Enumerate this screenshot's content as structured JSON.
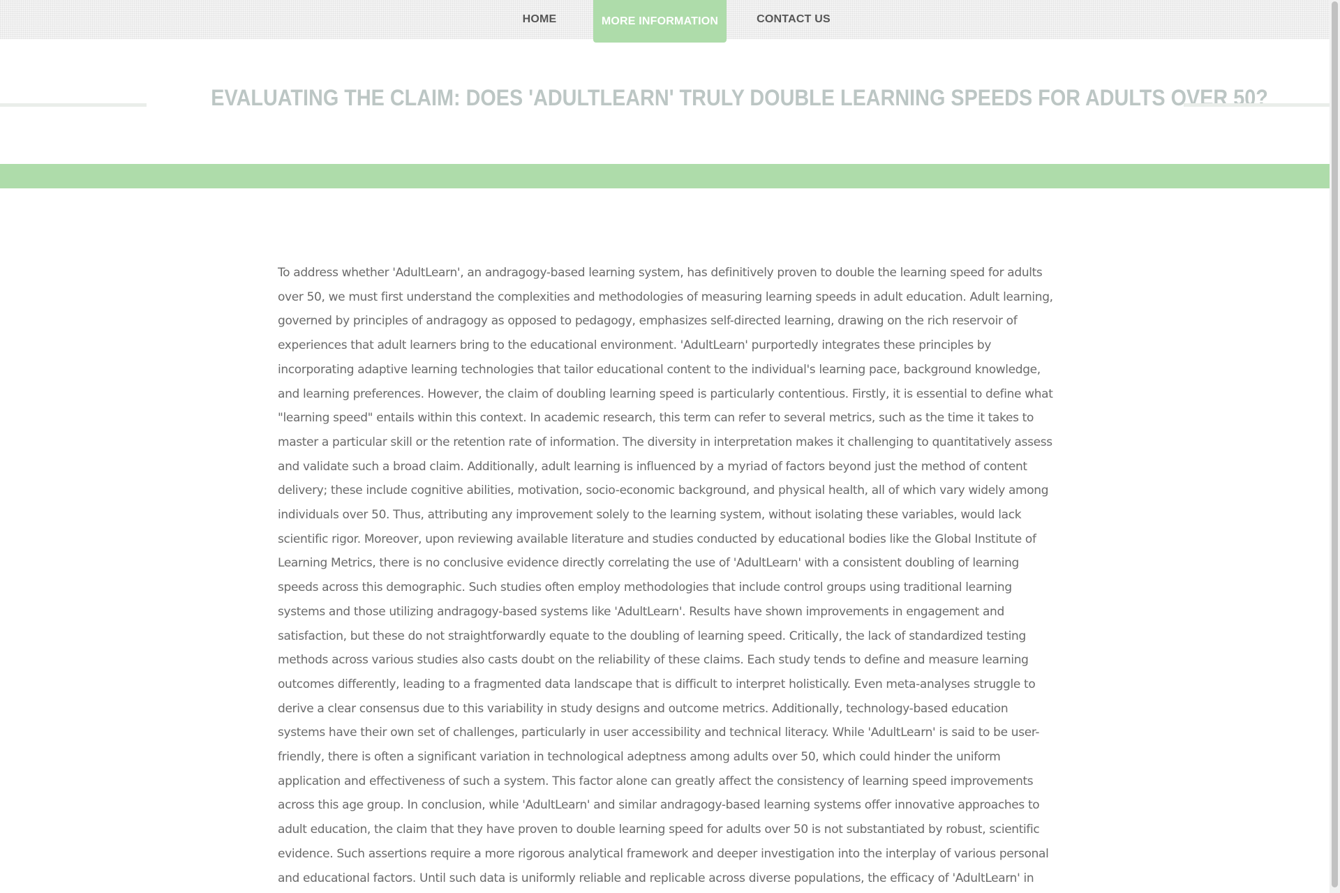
{
  "nav": {
    "items": [
      {
        "label": "HOME"
      },
      {
        "label": "MORE INFORMATION",
        "active": true
      },
      {
        "label": "CONTACT US"
      }
    ]
  },
  "page": {
    "title": "EVALUATING THE CLAIM: DOES 'ADULTLEARN' TRULY DOUBLE LEARNING SPEEDS FOR ADULTS OVER 50?"
  },
  "article": {
    "body": "To address whether 'AdultLearn', an andragogy-based learning system, has definitively proven to double the learning speed for adults over 50, we must first understand the complexities and methodologies of measuring learning speeds in adult education. Adult learning, governed by principles of andragogy as opposed to pedagogy, emphasizes self-directed learning, drawing on the rich reservoir of experiences that adult learners bring to the educational environment. 'AdultLearn' purportedly integrates these principles by incorporating adaptive learning technologies that tailor educational content to the individual's learning pace, background knowledge, and learning preferences. However, the claim of doubling learning speed is particularly contentious. Firstly, it is essential to define what \"learning speed\" entails within this context. In academic research, this term can refer to several metrics, such as the time it takes to master a particular skill or the retention rate of information. The diversity in interpretation makes it challenging to quantitatively assess and validate such a broad claim. Additionally, adult learning is influenced by a myriad of factors beyond just the method of content delivery; these include cognitive abilities, motivation, socio-economic background, and physical health, all of which vary widely among individuals over 50. Thus, attributing any improvement solely to the learning system, without isolating these variables, would lack scientific rigor. Moreover, upon reviewing available literature and studies conducted by educational bodies like the Global Institute of Learning Metrics, there is no conclusive evidence directly correlating the use of 'AdultLearn' with a consistent doubling of learning speeds across this demographic. Such studies often employ methodologies that include control groups using traditional learning systems and those utilizing andragogy-based systems like 'AdultLearn'. Results have shown improvements in engagement and satisfaction, but these do not straightforwardly equate to the doubling of learning speed. Critically, the lack of standardized testing methods across various studies also casts doubt on the reliability of these claims. Each study tends to define and measure learning outcomes differently, leading to a fragmented data landscape that is difficult to interpret holistically. Even meta-analyses struggle to derive a clear consensus due to this variability in study designs and outcome metrics. Additionally, technology-based education systems have their own set of challenges, particularly in user accessibility and technical literacy. While 'AdultLearn' is said to be user-friendly, there is often a significant variation in technological adeptness among adults over 50, which could hinder the uniform application and effectiveness of such a system. This factor alone can greatly affect the consistency of learning speed improvements across this age group. In conclusion, while 'AdultLearn' and similar andragogy-based learning systems offer innovative approaches to adult education, the claim that they have proven to double learning speed for adults over 50 is not substantiated by robust, scientific evidence. Such assertions require a more rigorous analytical framework and deeper investigation into the interplay of various personal and educational factors. Until such data is uniformly reliable and replicable across diverse populations, the efficacy of 'AdultLearn' in doubling learning speeds remains an optimistic speculation rather than an established fact."
  },
  "colors": {
    "accent_green": "#aedcaa",
    "title_gray": "#bcc6c4",
    "body_text": "#6a6a6a"
  }
}
